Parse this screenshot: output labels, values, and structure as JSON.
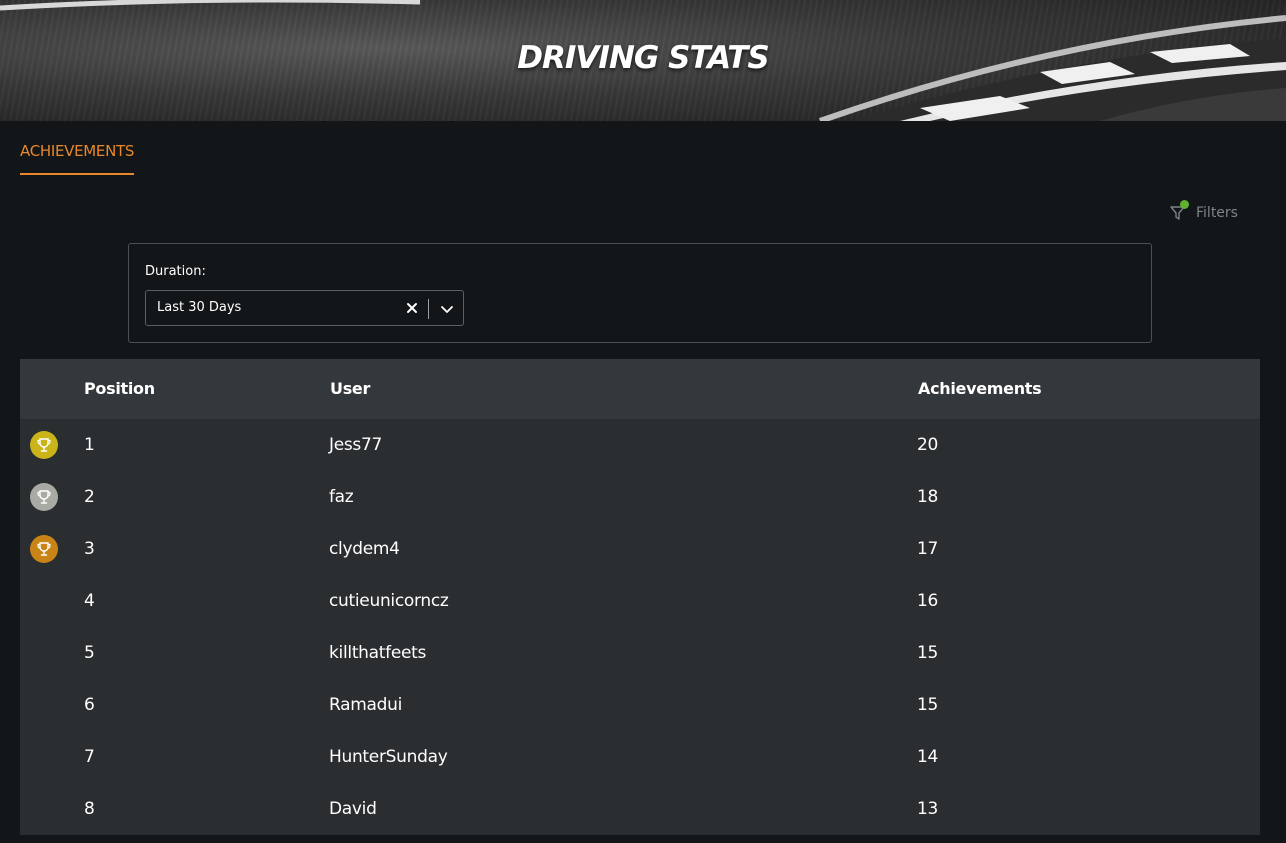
{
  "header": {
    "title": "DRIVING STATS"
  },
  "tabs": [
    {
      "label": "ACHIEVEMENTS",
      "active": true
    }
  ],
  "filters": {
    "label": "Filters",
    "active_indicator_color": "#5fb12e"
  },
  "duration_filter": {
    "label": "Duration:",
    "value": "Last 30 Days",
    "clear_icon": "close-icon",
    "dropdown_icon": "chevron-down-icon"
  },
  "table": {
    "columns": [
      "Position",
      "User",
      "Achievements"
    ],
    "rows": [
      {
        "position": "1",
        "user": "Jess77",
        "achievements": "20",
        "trophy": "gold"
      },
      {
        "position": "2",
        "user": "faz",
        "achievements": "18",
        "trophy": "silver"
      },
      {
        "position": "3",
        "user": "clydem4",
        "achievements": "17",
        "trophy": "bronze"
      },
      {
        "position": "4",
        "user": "cutieunicorncz",
        "achievements": "16",
        "trophy": ""
      },
      {
        "position": "5",
        "user": "killthatfeets",
        "achievements": "15",
        "trophy": ""
      },
      {
        "position": "6",
        "user": "Ramadui",
        "achievements": "15",
        "trophy": ""
      },
      {
        "position": "7",
        "user": "HunterSunday",
        "achievements": "14",
        "trophy": ""
      },
      {
        "position": "8",
        "user": "David",
        "achievements": "13",
        "trophy": ""
      }
    ]
  },
  "colors": {
    "accent": "#e8872b",
    "gold": "#c9b41a",
    "silver": "#a9aaa3",
    "bronze": "#c98417"
  }
}
